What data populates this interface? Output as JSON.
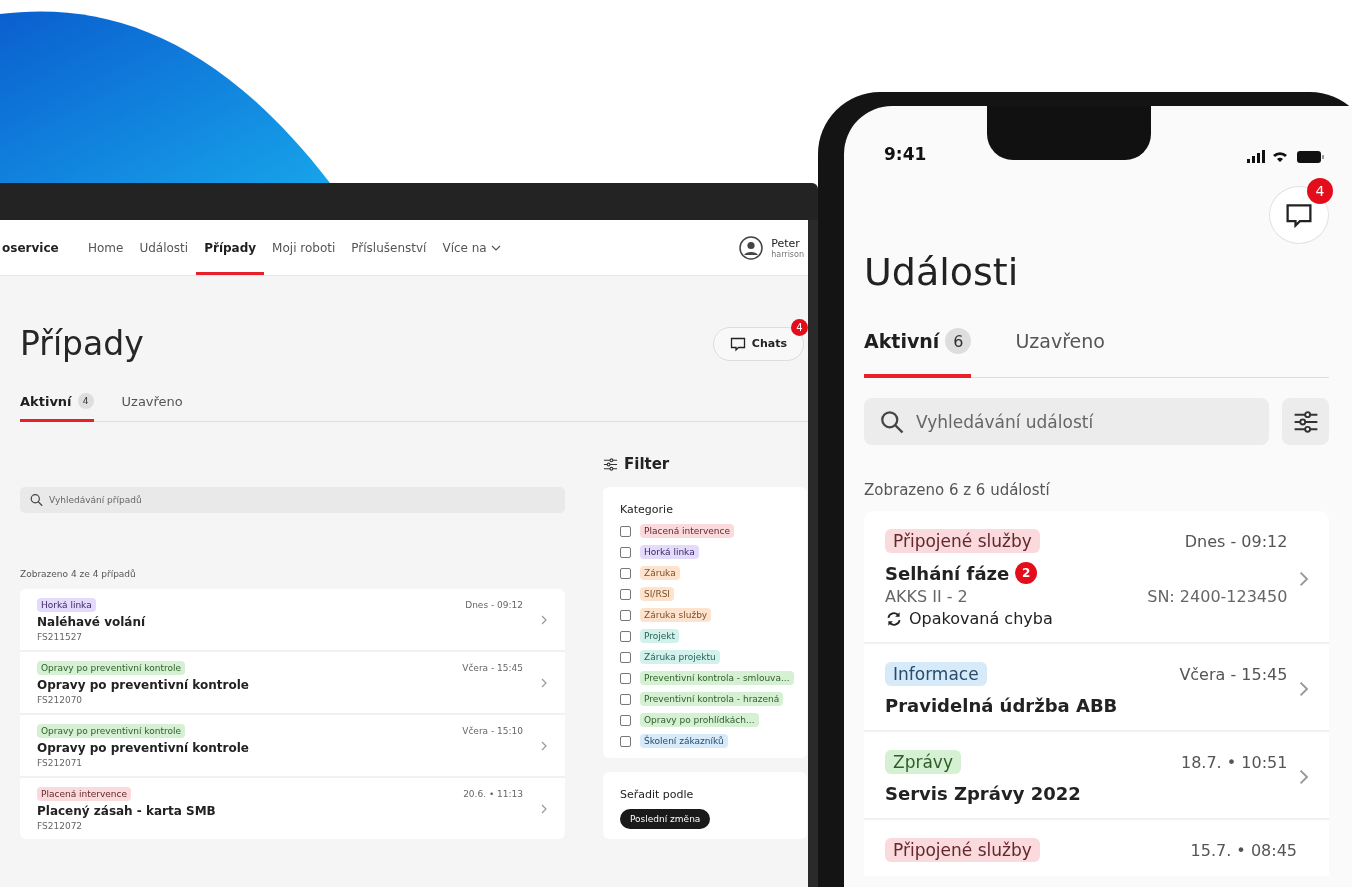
{
  "laptop": {
    "nav": {
      "brand": "oservice",
      "items": [
        {
          "label": "Home",
          "selected": false
        },
        {
          "label": "Události",
          "selected": false
        },
        {
          "label": "Případy",
          "selected": true
        },
        {
          "label": "Moji roboti",
          "selected": false
        },
        {
          "label": "Příslušenství",
          "selected": false
        },
        {
          "label": "Více na",
          "selected": false
        }
      ],
      "user": {
        "name": "Peter",
        "email": "harrison"
      }
    },
    "title": "Případy",
    "chats": {
      "label": "Chats",
      "badge": "4"
    },
    "tabs": [
      {
        "label": "Aktivní",
        "count": "4",
        "selected": true
      },
      {
        "label": "Uzavřeno",
        "selected": false
      }
    ],
    "search": {
      "placeholder": "Vyhledávání případů"
    },
    "result_count": "Zobrazeno 4 ze 4 případů",
    "cases": [
      {
        "tag": "Horká linka",
        "color": "#e4dafb",
        "date": "Dnes - 09:12",
        "title": "Naléhavé volání",
        "id": "FS211527"
      },
      {
        "tag": "Opravy po preventivní kontrole",
        "color": "#d5f0d2",
        "date": "Včera - 15:45",
        "title": "Opravy po preventivní kontrole",
        "id": "FS212070"
      },
      {
        "tag": "Opravy po preventivní kontrole",
        "color": "#d5f0d2",
        "date": "Včera - 15:10",
        "title": "Opravy po preventivní kontrole",
        "id": "FS212071"
      },
      {
        "tag": "Placená intervence",
        "color": "#fadadd",
        "date": "20.6. • 11:13",
        "title": "Placený zásah - karta SMB",
        "id": "FS212072"
      }
    ],
    "filter": {
      "title": "Filter",
      "category_heading": "Kategorie",
      "categories": [
        {
          "label": "Placená intervence",
          "color": "#fadadd",
          "checked": false
        },
        {
          "label": "Horká linka",
          "color": "#e4dafb",
          "checked": false
        },
        {
          "label": "Záruka",
          "color": "#fde3cd",
          "checked": false
        },
        {
          "label": "SI/RSI",
          "color": "#fde3cd",
          "checked": false
        },
        {
          "label": "Záruka služby",
          "color": "#fde3cd",
          "checked": false
        },
        {
          "label": "Projekt",
          "color": "#d2f1ec",
          "checked": false
        },
        {
          "label": "Záruka projektu",
          "color": "#d2f1ec",
          "checked": false
        },
        {
          "label": "Preventivní kontrola - smlouva...",
          "color": "#d5f0d2",
          "checked": false
        },
        {
          "label": "Preventivní kontrola - hrazená",
          "color": "#d5f0d2",
          "checked": false
        },
        {
          "label": "Opravy po prohlídkách...",
          "color": "#d5f0d2",
          "checked": false
        },
        {
          "label": "Školení zákazníků",
          "color": "#d6eafa",
          "checked": false
        }
      ],
      "sort": {
        "heading": "Seřadit podle",
        "options": [
          {
            "label": "Poslední změna",
            "selected": true
          }
        ]
      }
    }
  },
  "phone": {
    "time": "9:41",
    "chat_badge": "4",
    "title": "Události",
    "tabs": [
      {
        "label": "Aktivní",
        "count": "6",
        "selected": true
      },
      {
        "label": "Uzavřeno",
        "selected": false
      }
    ],
    "search": {
      "placeholder": "Vyhledávání událostí"
    },
    "result_count": "Zobrazeno 6 z 6 událostí",
    "events": [
      {
        "tag": "Připojené služby",
        "color": "#fadadd",
        "date": "Dnes - 09:12",
        "title": "Selhání fáze",
        "badge": "2",
        "model": "AKKS II - 2",
        "serial": "SN: 2400-123450",
        "note": "Opakovaná chyba"
      },
      {
        "tag": "Informace",
        "color": "#d6eafa",
        "date": "Včera - 15:45",
        "title": "Pravidelná údržba ABB"
      },
      {
        "tag": "Zprávy",
        "color": "#d5f0d2",
        "date": "18.7. • 10:51",
        "title": "Servis Zprávy 2022"
      },
      {
        "tag": "Připojené služby",
        "color": "#fadadd",
        "date": "15.7. • 08:45"
      }
    ]
  }
}
